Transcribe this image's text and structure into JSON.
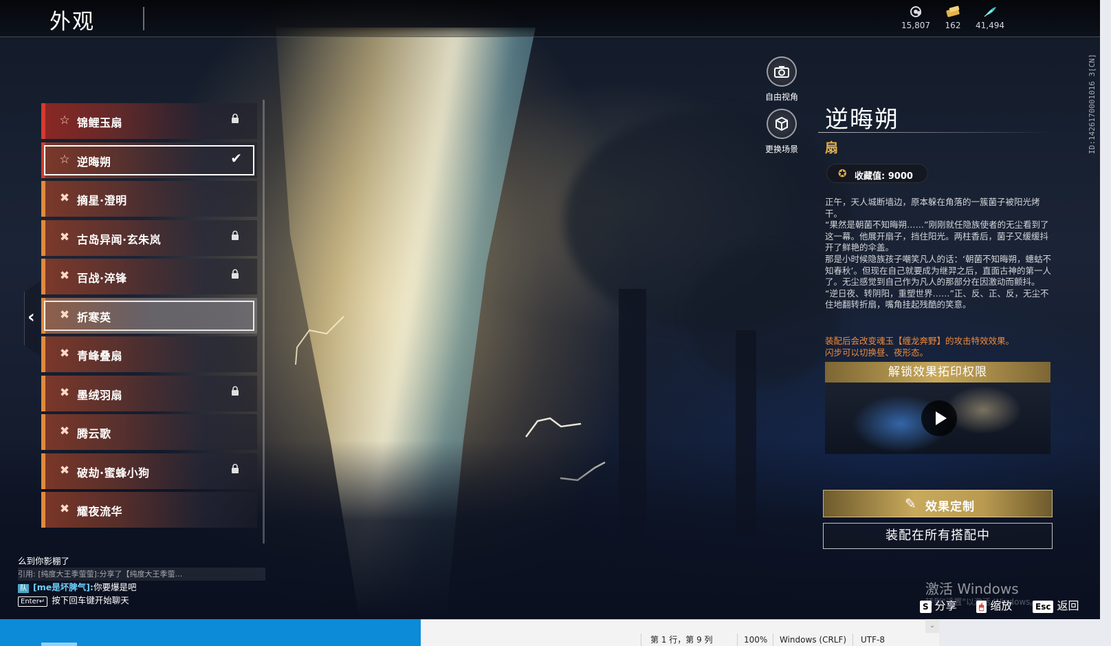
{
  "header": {
    "title": "外观",
    "currencies": [
      {
        "icon": "spirit-coin-icon",
        "value": "15,807"
      },
      {
        "icon": "ticket-icon",
        "value": "162"
      },
      {
        "icon": "feather-icon",
        "value": "41,494"
      }
    ]
  },
  "list": {
    "items": [
      {
        "name": "锦鲤玉扇",
        "glyph": "☆",
        "locked": true,
        "style": "red"
      },
      {
        "name": "逆晦朔",
        "glyph": "☆",
        "locked": false,
        "style": "selected",
        "equipped": true
      },
      {
        "name": "摘星·澄明",
        "glyph": "✖",
        "locked": false,
        "style": "normal"
      },
      {
        "name": "古岛异闻·玄朱岚",
        "glyph": "✖",
        "locked": true,
        "style": "normal"
      },
      {
        "name": "百战·淬锋",
        "glyph": "✖",
        "locked": true,
        "style": "normal"
      },
      {
        "name": "折寒英",
        "glyph": "✖",
        "locked": false,
        "style": "hover"
      },
      {
        "name": "青峰叠扇",
        "glyph": "✖",
        "locked": false,
        "style": "normal"
      },
      {
        "name": "墨绒羽扇",
        "glyph": "✖",
        "locked": true,
        "style": "normal"
      },
      {
        "name": "腾云歌",
        "glyph": "✖",
        "locked": false,
        "style": "normal"
      },
      {
        "name": "破劫·蜜蜂小狗",
        "glyph": "✖",
        "locked": true,
        "style": "normal"
      },
      {
        "name": "耀夜流华",
        "glyph": "✖",
        "locked": false,
        "style": "normal"
      }
    ]
  },
  "camera": {
    "free_view": "自由视角",
    "change_scene": "更换场景"
  },
  "detail": {
    "title": "逆晦朔",
    "type": "扇",
    "collect_label": "收藏值: 9000",
    "description": "正午，天人城断墙边，原本躲在角落的一簇菌子被阳光烤干。\n“果然是朝菌不知晦朔……”刚刚就任隐族使者的无尘看到了这一幕。他展开扇子，挡住阳光。两柱香后，菌子又缓缓抖开了鲜艳的伞盖。\n那是小时候隐族孩子嘲笑凡人的话：‘朝菌不知晦朔，蟪蛄不知春秋’。但现在自己就要成为继羿之后，直面古神的第一人了。无尘感觉到自己作为凡人的那部分在因激动而颤抖。\n“逆日夜、转阴阳，重塑世界……”正、反、正、反，无尘不住地翻转折扇，嘴角挂起残酷的笑意。",
    "effect_note": "装配后会改变魂玉【缠龙奔野】的攻击特效效果。\n闪步可以切换昼、夜形态。",
    "unlock_title": "解锁效果拓印权限",
    "btn_effect": "效果定制",
    "btn_equip": "装配在所有搭配中"
  },
  "uid": "ID:1426170001016 3[CN]",
  "chat": {
    "line1": "么到你影棚了",
    "quote": "引用: [纯度大王季萤萤]:分享了【纯度大王季萤…",
    "tag": "队",
    "speaker": "[me是坏脾气]:",
    "message": "你要爆是吧",
    "enter_key": "Enter↵",
    "enter_hint": "按下回车键开始聊天"
  },
  "watermark": {
    "title": "激活 Windows",
    "sub": "转到\"设置\"以激活 Windows。"
  },
  "hints": {
    "share_key": "S",
    "share_label": "分享",
    "zoom_key": "🖱",
    "zoom_label": "缩放",
    "back_key": "Esc",
    "back_label": "返回"
  },
  "editor_status": {
    "position": "第 1 行，第 9 列",
    "zoom": "100%",
    "line_ending": "Windows (CRLF)",
    "encoding": "UTF-8"
  }
}
